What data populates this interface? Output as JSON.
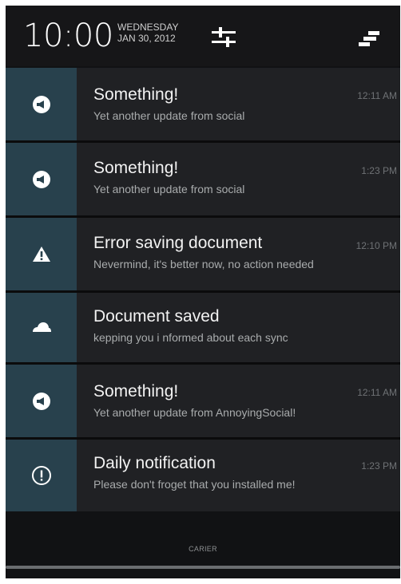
{
  "header": {
    "time": "10:00",
    "day": "WEDNESDAY",
    "date": "JAN 30, 2012",
    "settings_icon": "sliders-icon",
    "toggle_icon": "quick-toggle-icon"
  },
  "notifications": [
    {
      "icon": "megaphone-icon",
      "title": "Something!",
      "text": "Yet another update from social",
      "time": "12:11 AM"
    },
    {
      "icon": "megaphone-icon",
      "title": "Something!",
      "text": "Yet another update from social",
      "time": "1:23 PM"
    },
    {
      "icon": "warning-icon",
      "title": "Error saving document",
      "text": "Nevermind, it's better now, no action needed",
      "time": "12:10 PM"
    },
    {
      "icon": "cloud-icon",
      "title": "Document saved",
      "text": "kepping you i nformed about each sync",
      "time": ""
    },
    {
      "icon": "megaphone-icon",
      "title": "Something!",
      "text": "Yet another update from AnnoyingSocial!",
      "time": "12:11 AM"
    },
    {
      "icon": "info-alert-icon",
      "title": "Daily notification",
      "text": "Please don't  froget that you installed me!",
      "time": "1:23 PM"
    }
  ],
  "footer": {
    "carrier": "CARIER"
  },
  "colors": {
    "background": "#111214",
    "row": "#202124",
    "icon_cell": "#28414d",
    "title": "#f2f2f2",
    "subtitle": "#a9acad",
    "time": "#6f7275"
  }
}
